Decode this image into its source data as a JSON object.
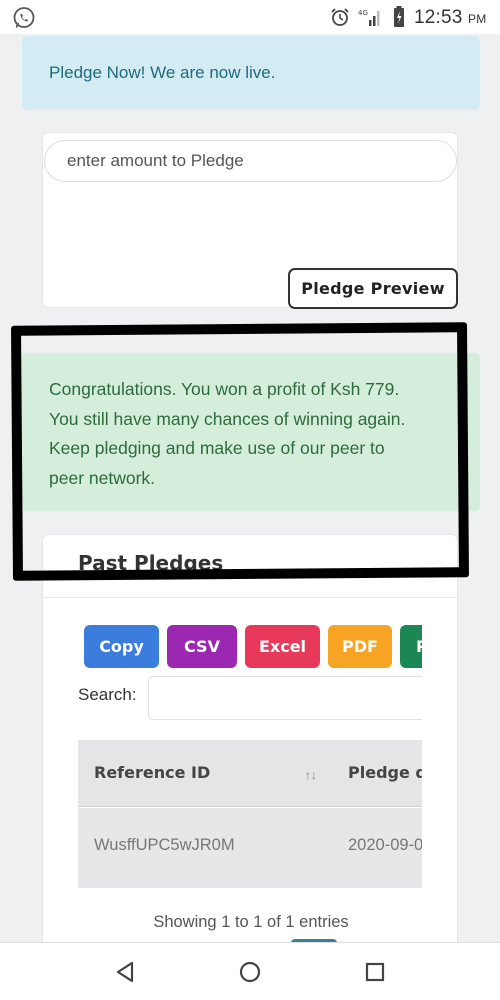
{
  "status_bar": {
    "time": "12:53",
    "ampm": "PM",
    "network": "4G",
    "icons": [
      "whatsapp-icon",
      "alarm-icon",
      "signal-icon",
      "battery-icon"
    ]
  },
  "info_alert": {
    "text": "Pledge Now! We are now live."
  },
  "pledge_form": {
    "amount_placeholder": "enter amount to Pledge",
    "preview_button": "Pledge Preview"
  },
  "success_alert": {
    "lines": [
      "Congratulations. You won a profit of Ksh 779.",
      "You still have many chances of winning again.",
      "Keep pledging and make use of our peer to",
      "peer network."
    ]
  },
  "past_pledges": {
    "title": "Past Pledges",
    "export_buttons": [
      {
        "label": "Copy",
        "color": "#3b7ddd"
      },
      {
        "label": "CSV",
        "color": "#9c27b0"
      },
      {
        "label": "Excel",
        "color": "#e8395a"
      },
      {
        "label": "PDF",
        "color": "#f7a324"
      },
      {
        "label": "P",
        "color": "#1a8754"
      }
    ],
    "search_label": "Search:",
    "columns": [
      "Reference ID",
      "Pledge da"
    ],
    "rows": [
      {
        "reference_id": "WusffUPC5wJR0M",
        "pledge_date": "2020-09-0"
      }
    ],
    "info": "Showing 1 to 1 of 1 entries"
  },
  "nav_bar": {
    "buttons": [
      "back-icon",
      "home-icon",
      "recents-icon"
    ]
  },
  "colors": {
    "info_bg": "#d3ecf3",
    "success_bg": "#d5eedc",
    "highlight_border": "#000000"
  }
}
